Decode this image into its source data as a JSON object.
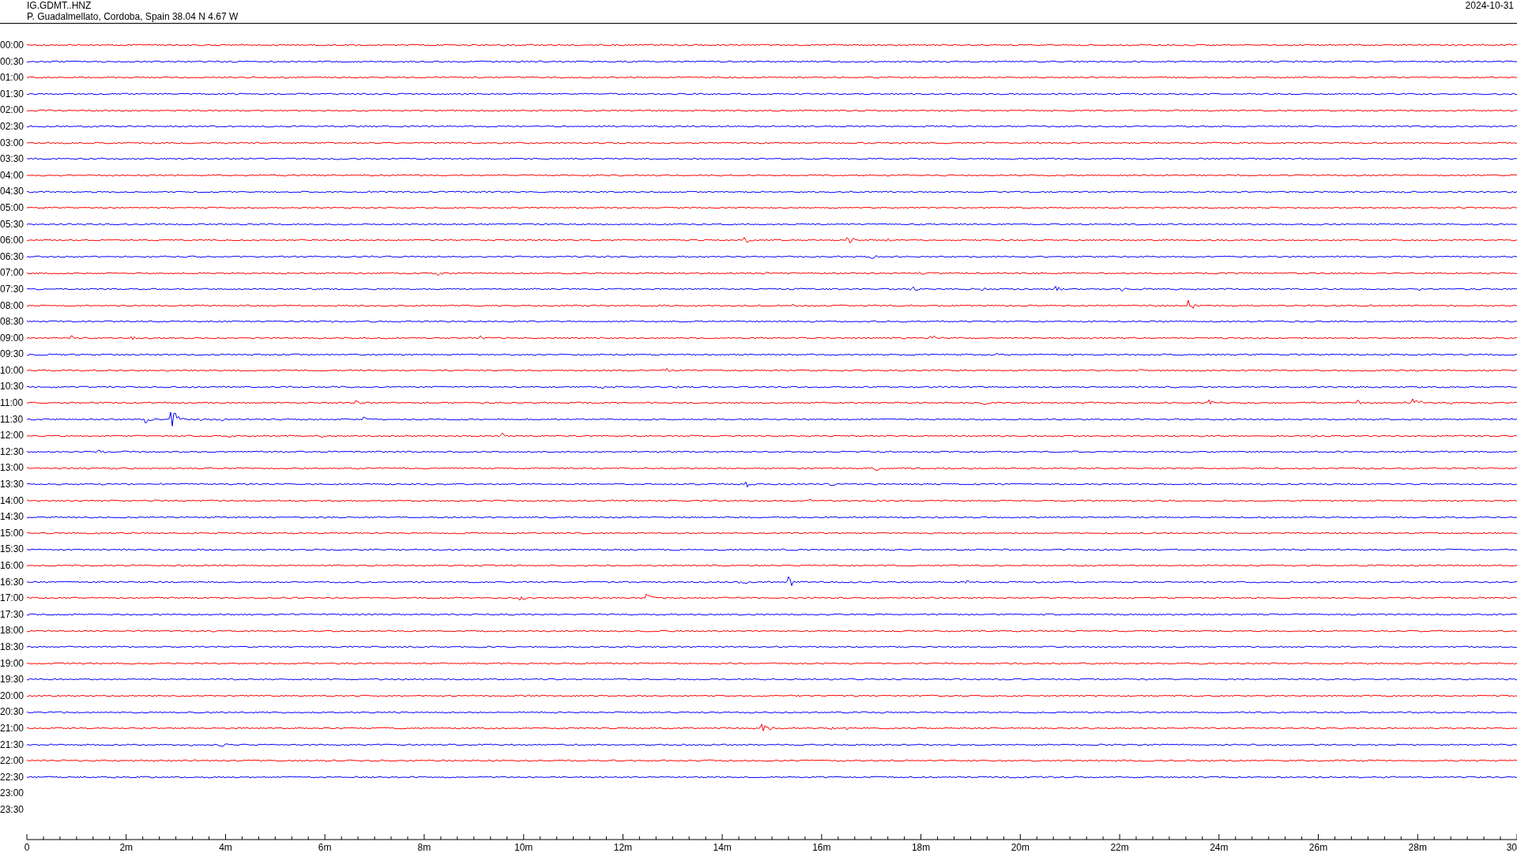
{
  "header": {
    "station": "IG.GDMT..HNZ",
    "location": "P. Guadalmellato, Cordoba, Spain  38.04 N 4.67 W",
    "date": "2024-10-31"
  },
  "rows": [
    {
      "time": "00:00",
      "color": "#ff0000"
    },
    {
      "time": "00:30",
      "color": "#0000ff"
    },
    {
      "time": "01:00",
      "color": "#ff0000"
    },
    {
      "time": "01:30",
      "color": "#0000ff"
    },
    {
      "time": "02:00",
      "color": "#ff0000"
    },
    {
      "time": "02:30",
      "color": "#0000ff"
    },
    {
      "time": "03:00",
      "color": "#ff0000"
    },
    {
      "time": "03:30",
      "color": "#0000ff"
    },
    {
      "time": "04:00",
      "color": "#ff0000"
    },
    {
      "time": "04:30",
      "color": "#0000ff"
    },
    {
      "time": "05:00",
      "color": "#ff0000"
    },
    {
      "time": "05:30",
      "color": "#0000ff"
    },
    {
      "time": "06:00",
      "color": "#ff0000"
    },
    {
      "time": "06:30",
      "color": "#0000ff"
    },
    {
      "time": "07:00",
      "color": "#ff0000"
    },
    {
      "time": "07:30",
      "color": "#0000ff"
    },
    {
      "time": "08:00",
      "color": "#ff0000"
    },
    {
      "time": "08:30",
      "color": "#0000ff"
    },
    {
      "time": "09:00",
      "color": "#ff0000"
    },
    {
      "time": "09:30",
      "color": "#0000ff"
    },
    {
      "time": "10:00",
      "color": "#ff0000"
    },
    {
      "time": "10:30",
      "color": "#0000ff"
    },
    {
      "time": "11:00",
      "color": "#ff0000"
    },
    {
      "time": "11:30",
      "color": "#0000ff"
    },
    {
      "time": "12:00",
      "color": "#ff0000"
    },
    {
      "time": "12:30",
      "color": "#0000ff"
    },
    {
      "time": "13:00",
      "color": "#ff0000"
    },
    {
      "time": "13:30",
      "color": "#0000ff"
    },
    {
      "time": "14:00",
      "color": "#ff0000"
    },
    {
      "time": "14:30",
      "color": "#0000ff"
    },
    {
      "time": "15:00",
      "color": "#ff0000"
    },
    {
      "time": "15:30",
      "color": "#0000ff"
    },
    {
      "time": "16:00",
      "color": "#ff0000"
    },
    {
      "time": "16:30",
      "color": "#0000ff"
    },
    {
      "time": "17:00",
      "color": "#ff0000"
    },
    {
      "time": "17:30",
      "color": "#0000ff"
    },
    {
      "time": "18:00",
      "color": "#ff0000"
    },
    {
      "time": "18:30",
      "color": "#0000ff"
    },
    {
      "time": "19:00",
      "color": "#ff0000"
    },
    {
      "time": "19:30",
      "color": "#0000ff"
    },
    {
      "time": "20:00",
      "color": "#ff0000"
    },
    {
      "time": "20:30",
      "color": "#0000ff"
    },
    {
      "time": "21:00",
      "color": "#ff0000"
    },
    {
      "time": "21:30",
      "color": "#0000ff"
    },
    {
      "time": "22:00",
      "color": "#ff0000"
    },
    {
      "time": "22:30",
      "color": "#0000ff"
    },
    {
      "time": "23:00"
    },
    {
      "time": "23:30"
    }
  ],
  "axis": {
    "labels": [
      "0",
      "2m",
      "4m",
      "6m",
      "8m",
      "10m",
      "12m",
      "14m",
      "16m",
      "18m",
      "20m",
      "22m",
      "24m",
      "26m",
      "28m",
      "30"
    ]
  }
}
